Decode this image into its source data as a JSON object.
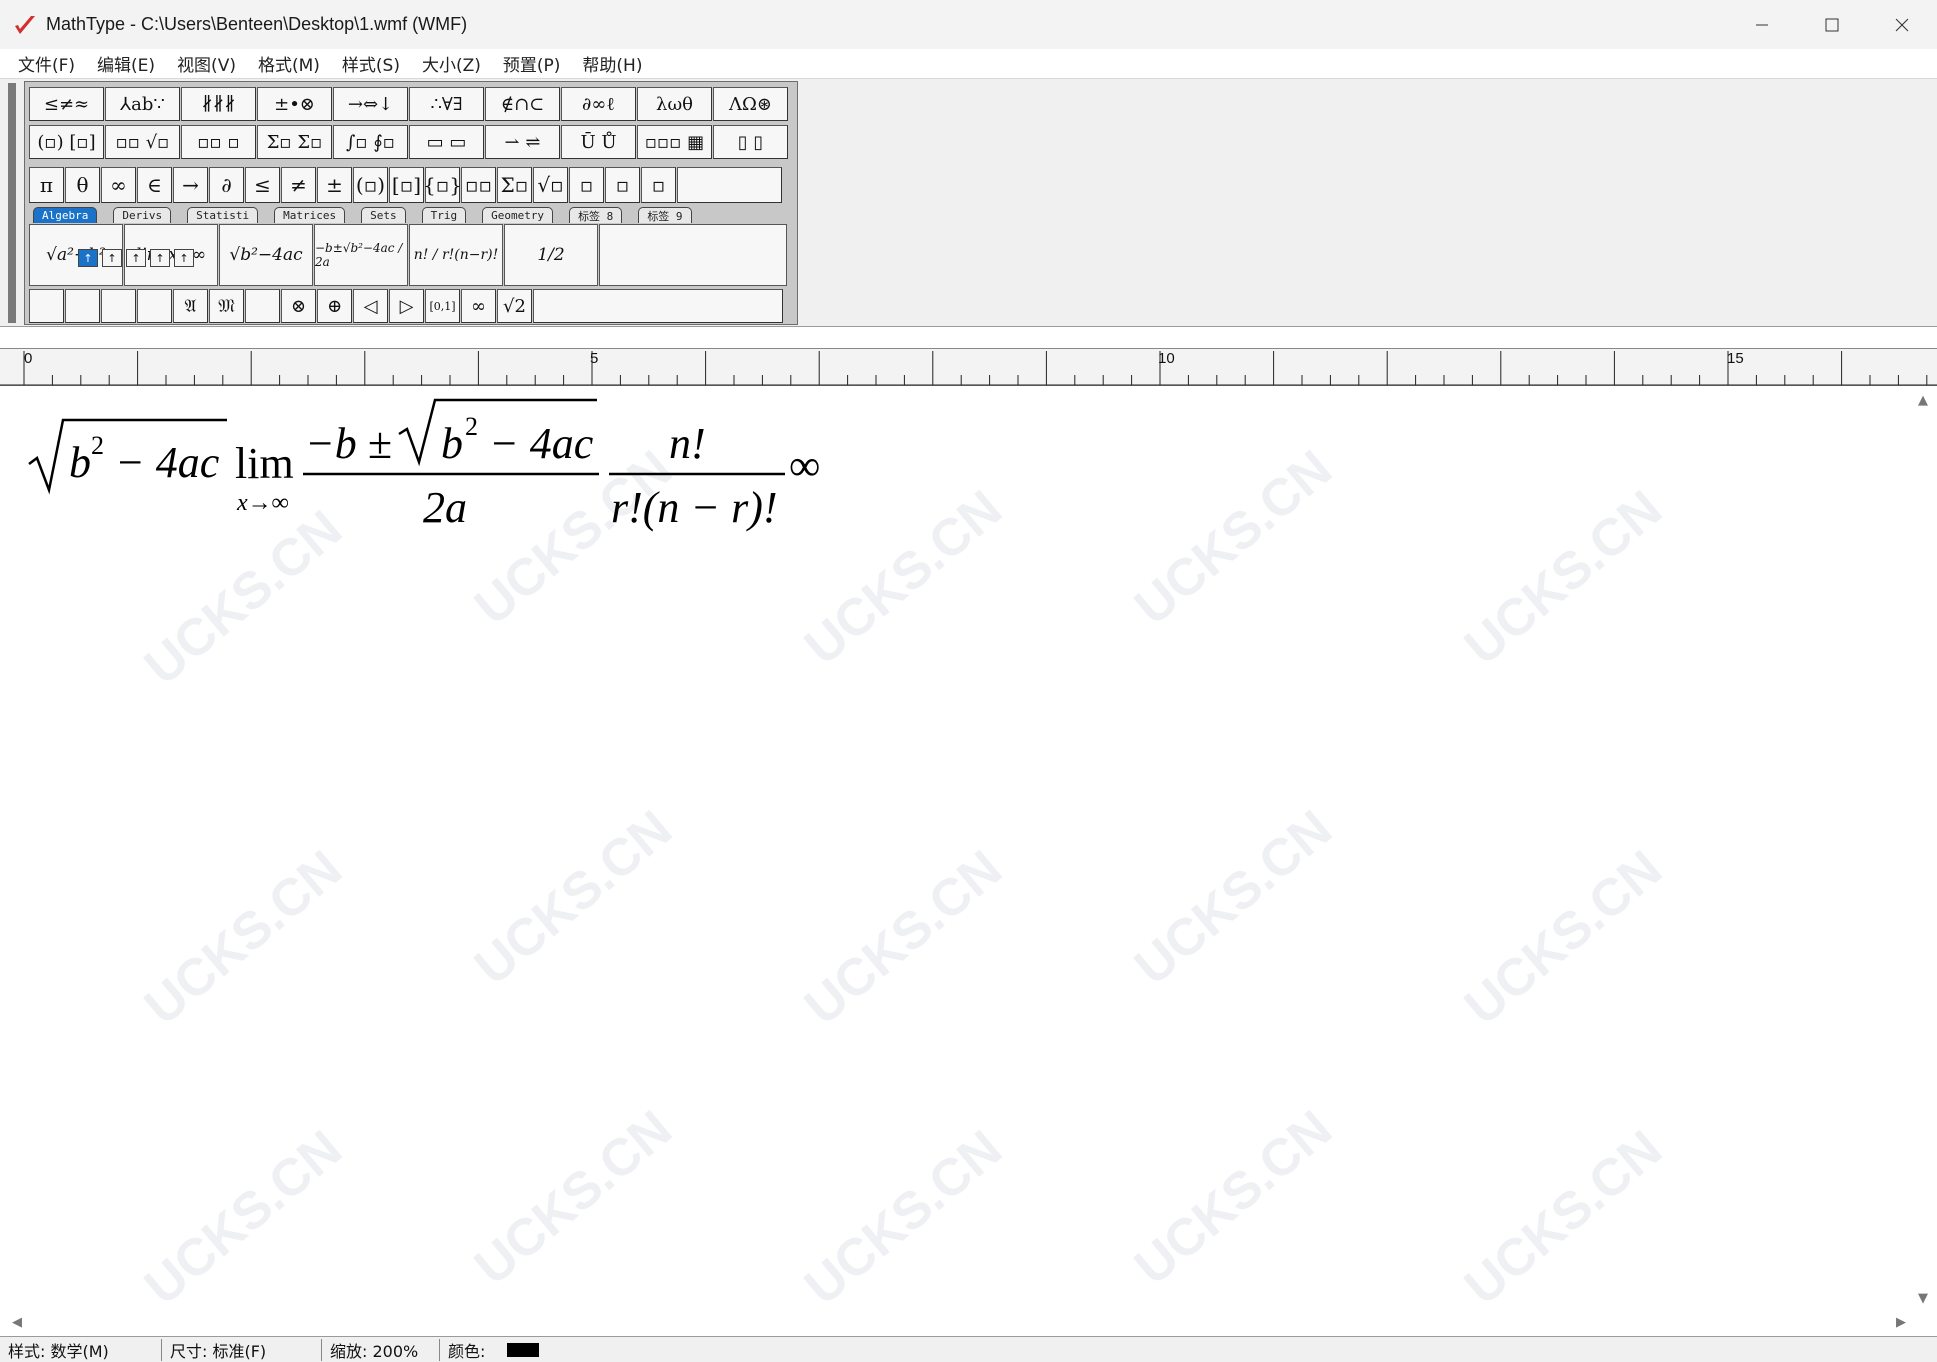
{
  "window": {
    "title": "MathType - C:\\Users\\Benteen\\Desktop\\1.wmf (WMF)",
    "minimize": "—",
    "maximize": "☐",
    "close": "✕"
  },
  "menu": [
    "文件(F)",
    "编辑(E)",
    "视图(V)",
    "格式(M)",
    "样式(S)",
    "大小(Z)",
    "预置(P)",
    "帮助(H)"
  ],
  "palette": {
    "row1": [
      "≤≠≈",
      "⅄ab∵",
      "∦∦∦",
      "±•⊗",
      "→⇔↓",
      "∴∀∃",
      "∉∩⊂",
      "∂∞ℓ",
      "λωθ",
      "ΛΩ⊛"
    ],
    "row2": [
      "(▫) [▫]",
      "▫▫ √▫",
      "▫▫ ▫",
      "Σ▫ Σ▫",
      "∫▫ ∮▫",
      "▭ ▭",
      "⇀ ⇌",
      "Ū Ů",
      "▫▫▫ ▦",
      "▯ ▯"
    ],
    "row3": [
      "π",
      "θ",
      "∞",
      "∈",
      "→",
      "∂",
      "≤",
      "≠",
      "±",
      "(▫)",
      "[▫]",
      "{▫}",
      "▫▫",
      "Σ▫",
      "√▫",
      "▫",
      "▫",
      "▫",
      ""
    ],
    "tabs": [
      "Algebra",
      "Derivs",
      "Statisti",
      "Matrices",
      "Sets",
      "Trig",
      "Geometry",
      "标签 8",
      "标签 9"
    ],
    "templates": [
      "√a²+b²",
      "lim x→∞",
      "√b²−4ac",
      "−b±√b²−4ac / 2a",
      "n! / r!(n−r)!",
      "1/2",
      ""
    ],
    "row5": [
      "",
      "",
      "",
      "",
      "𝔄",
      "𝔐",
      "",
      "⊗",
      "⊕",
      "◁",
      "▷",
      "[0,1]",
      "∞",
      "√2",
      ""
    ],
    "nudges": [
      "↑",
      "↑",
      "↑",
      "↑",
      "↑"
    ]
  },
  "ruler": {
    "marks": [
      "0",
      "5",
      "10",
      "15"
    ]
  },
  "formula": {
    "sqrt1_b": "b",
    "sqrt1_exp": "2",
    "sqrt1_rest": "− 4ac",
    "lim": "lim",
    "lim_sub": "x→∞",
    "frac1_num_pre": "−b ±",
    "frac1_num_b": "b",
    "frac1_num_exp": "2",
    "frac1_num_rest": "− 4ac",
    "frac1_den": "2a",
    "frac2_num": "n!",
    "frac2_den": "r!(n − r)!",
    "inf": "∞"
  },
  "watermark": "UCKS.CN",
  "status": {
    "style": "样式: 数学(M)",
    "size": "尺寸: 标准(F)",
    "zoom": "缩放: 200%",
    "color": "颜色:"
  },
  "colors": {
    "accent": "#1a73c9",
    "logo": "#d32f2f",
    "swatch": "#000000"
  }
}
